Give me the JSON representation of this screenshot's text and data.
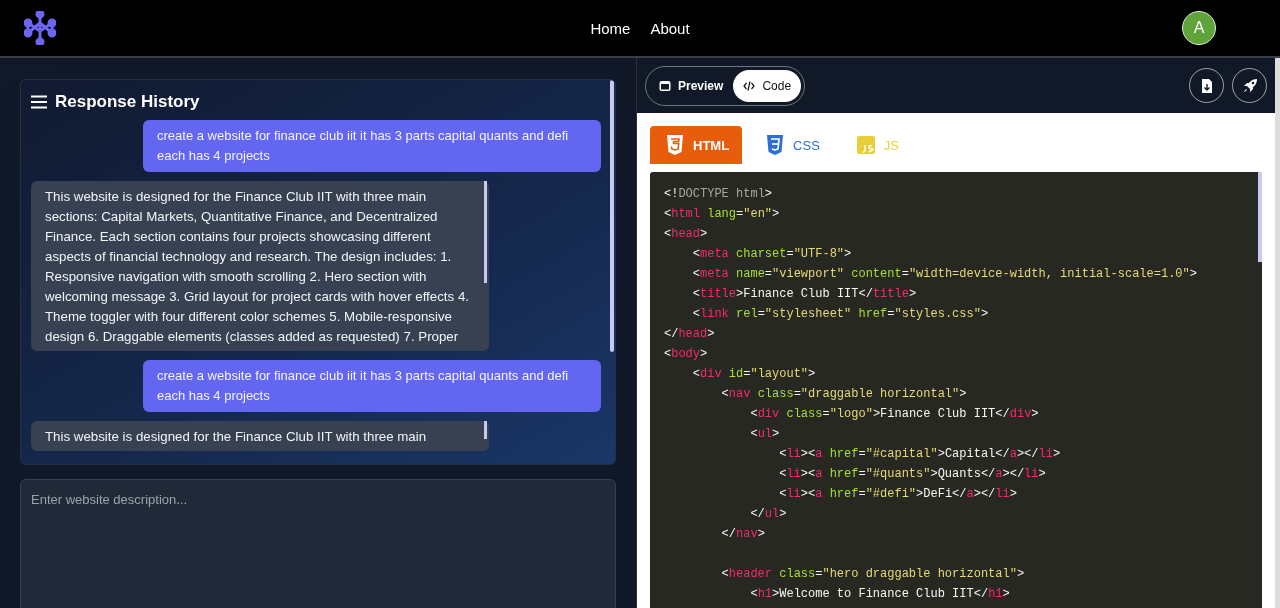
{
  "header": {
    "nav": [
      {
        "label": "Home"
      },
      {
        "label": "About"
      }
    ],
    "avatar": "A"
  },
  "history": {
    "title": "Response History",
    "messages": [
      {
        "kind": "user",
        "text": "create a website for finance club iit it has 3 parts capital quants and defi each has 4 projects"
      },
      {
        "kind": "assistant",
        "text": "This website is designed for the Finance Club IIT with three main sections: Capital Markets, Quantitative Finance, and Decentralized Finance. Each section contains four projects showcasing different aspects of financial technology and research. The design includes: 1. Responsive navigation with smooth scrolling 2. Hero section with welcoming message 3. Grid layout for project cards with hover effects 4. Theme toggler with four different color schemes 5. Mobile-responsive design 6. Draggable elements (classes added as requested) 7. Proper"
      },
      {
        "kind": "user",
        "text": "create a website for finance club iit it has 3 parts capital quants and defi each has 4 projects"
      },
      {
        "kind": "assistant",
        "text": "This website is designed for the Finance Club IIT with three main"
      }
    ]
  },
  "prompt": {
    "placeholder": "Enter website description..."
  },
  "view_toggle": [
    {
      "label": "Preview",
      "kind": "preview",
      "selected": false
    },
    {
      "label": "Code",
      "kind": "code",
      "selected": true
    }
  ],
  "file_tabs": [
    {
      "label": "HTML",
      "kind": "html",
      "selected": true
    },
    {
      "label": "CSS",
      "kind": "css",
      "selected": false
    },
    {
      "label": "JS",
      "kind": "js",
      "selected": false
    }
  ],
  "code": {
    "lines": [
      "<!DOCTYPE html>",
      "<html lang=\"en\">",
      "<head>",
      "    <meta charset=\"UTF-8\">",
      "    <meta name=\"viewport\" content=\"width=device-width, initial-scale=1.0\">",
      "    <title>Finance Club IIT</title>",
      "    <link rel=\"stylesheet\" href=\"styles.css\">",
      "</head>",
      "<body>",
      "    <div id=\"layout\">",
      "        <nav class=\"draggable horizontal\">",
      "            <div class=\"logo\">Finance Club IIT</div>",
      "            <ul>",
      "                <li><a href=\"#capital\">Capital</a></li>",
      "                <li><a href=\"#quants\">Quants</a></li>",
      "                <li><a href=\"#defi\">DeFi</a></li>",
      "            </ul>",
      "        </nav>",
      {
        "text": "        <header class=\"hero draggable horizontal\">",
        "gap_before": true
      },
      "            <h1>Welcome to Finance Club IIT</h1>"
    ]
  }
}
